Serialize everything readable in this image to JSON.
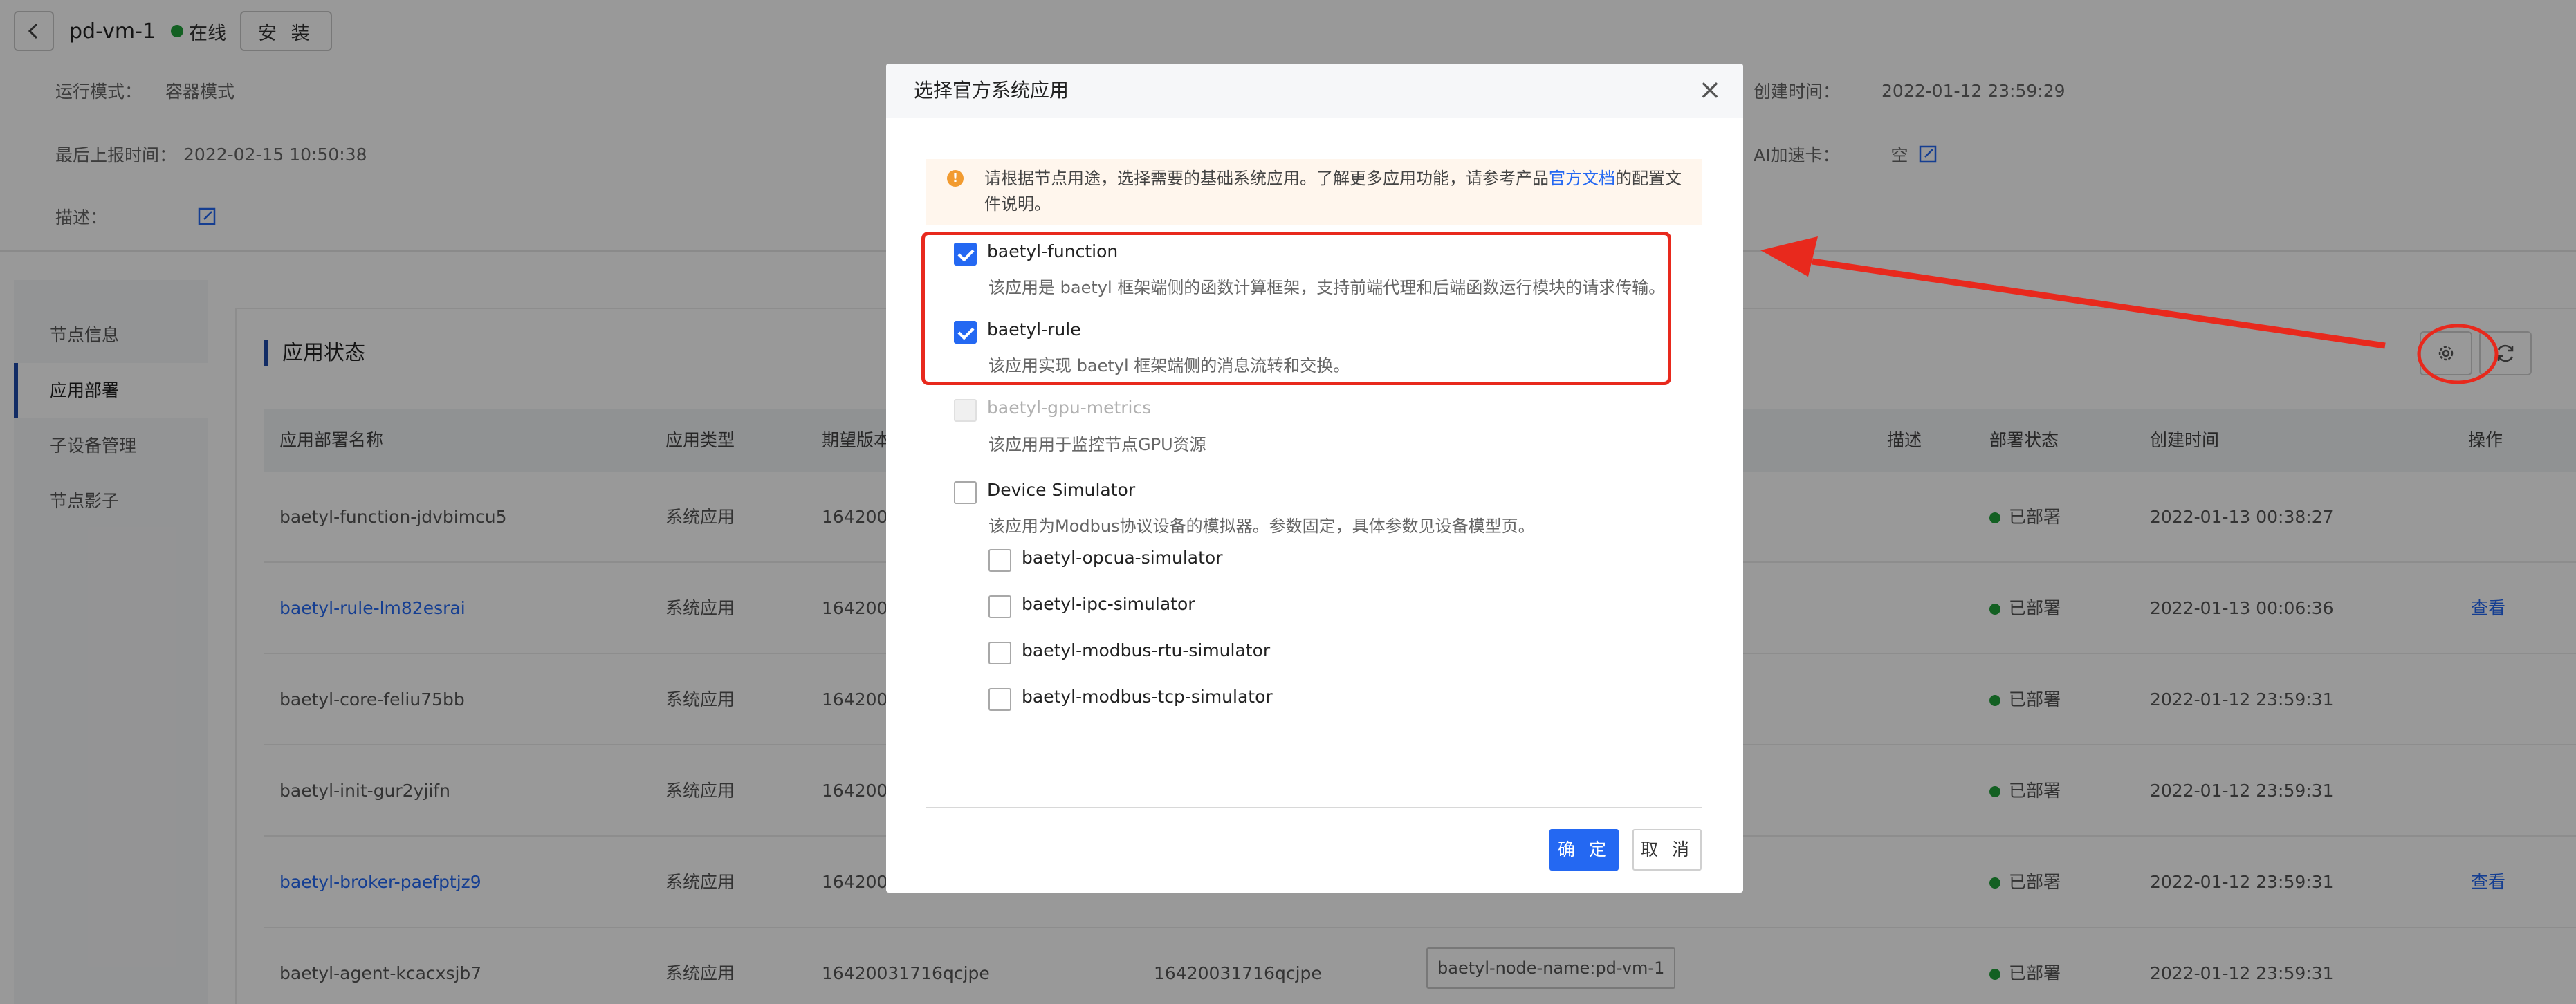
{
  "header": {
    "device_name": "pd-vm-1",
    "status": "在线",
    "install_label": "安 装"
  },
  "info": {
    "run_mode_label": "运行模式：",
    "run_mode_value": "容器模式",
    "last_report_label": "最后上报时间：",
    "last_report_value": "2022-02-15 10:50:38",
    "desc_label": "描述：",
    "created_label": "创建时间：",
    "created_value": "2022-01-12 23:59:29",
    "ai_label": "AI加速卡：",
    "ai_value": "空"
  },
  "nav": {
    "items": [
      {
        "label": "节点信息"
      },
      {
        "label": "应用部署"
      },
      {
        "label": "子设备管理"
      },
      {
        "label": "节点影子"
      }
    ]
  },
  "section": {
    "title": "应用状态"
  },
  "table": {
    "headers": {
      "name": "应用部署名称",
      "type": "应用类型",
      "expected_version": "期望版本",
      "desc": "描述",
      "status": "部署状态",
      "created": "创建时间",
      "ops": "操作"
    },
    "rows": [
      {
        "name": "baetyl-function-jdvbimcu5",
        "type": "系统应用",
        "expected": "1642005",
        "actual": "",
        "tag": "",
        "status": "已部署",
        "created": "2022-01-13 00:38:27",
        "op": ""
      },
      {
        "name": "baetyl-rule-lm82esrai",
        "type": "系统应用",
        "expected": "1642003",
        "actual": "",
        "tag": "",
        "status": "已部署",
        "created": "2022-01-13 00:06:36",
        "op": "查看"
      },
      {
        "name": "baetyl-core-feliu75bb",
        "type": "系统应用",
        "expected": "1642003",
        "actual": "",
        "tag": "",
        "status": "已部署",
        "created": "2022-01-12 23:59:31",
        "op": ""
      },
      {
        "name": "baetyl-init-gur2yjifn",
        "type": "系统应用",
        "expected": "1642003",
        "actual": "",
        "tag": "",
        "status": "已部署",
        "created": "2022-01-12 23:59:31",
        "op": ""
      },
      {
        "name": "baetyl-broker-paefptjz9",
        "type": "系统应用",
        "expected": "1642005",
        "actual": "",
        "tag": "",
        "status": "已部署",
        "created": "2022-01-12 23:59:31",
        "op": "查看"
      },
      {
        "name": "baetyl-agent-kcacxsjb7",
        "type": "系统应用",
        "expected": "16420031716qcjpe",
        "actual": "16420031716qcjpe",
        "tag": "baetyl-node-name:pd-vm-1",
        "status": "已部署",
        "created": "2022-01-12 23:59:31",
        "op": ""
      }
    ]
  },
  "modal": {
    "title": "选择官方系统应用",
    "close": "×",
    "notice_pre": "请根据节点用途，选择需要的基础系统应用。了解更多应用功能，请参考产品",
    "notice_link": "官方文档",
    "notice_post": "的配置文件说明。",
    "options": [
      {
        "label": "baetyl-function",
        "desc": "该应用是 baetyl 框架端侧的函数计算框架，支持前端代理和后端函数运行模块的请求传输。",
        "checked": true,
        "disabled": false
      },
      {
        "label": "baetyl-rule",
        "desc": "该应用实现 baetyl 框架端侧的消息流转和交换。",
        "checked": true,
        "disabled": false
      },
      {
        "label": "baetyl-gpu-metrics",
        "desc": "该应用用于监控节点GPU资源",
        "checked": false,
        "disabled": true
      },
      {
        "label": "Device Simulator",
        "desc": "该应用为Modbus协议设备的模拟器。参数固定，具体参数见设备模型页。",
        "checked": false,
        "disabled": false
      }
    ],
    "sub_options": [
      {
        "label": "baetyl-opcua-simulator"
      },
      {
        "label": "baetyl-ipc-simulator"
      },
      {
        "label": "baetyl-modbus-rtu-simulator"
      },
      {
        "label": "baetyl-modbus-tcp-simulator"
      }
    ],
    "ok_label": "确 定",
    "cancel_label": "取 消"
  },
  "colors": {
    "accent": "#2468f2",
    "online": "#21a03a",
    "annotation": "#e8291d",
    "warning": "#f29b30"
  }
}
